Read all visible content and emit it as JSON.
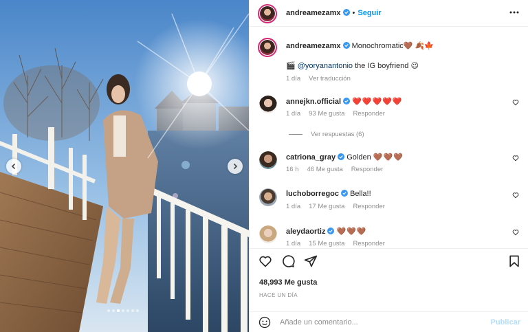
{
  "post": {
    "author": "andreamezamx",
    "follow_label": "Seguir",
    "more_icon": "more-options-icon",
    "carousel": {
      "total": 7,
      "current": 3
    }
  },
  "caption": {
    "author": "andreamezamx",
    "text": "Monochromatic",
    "emojis": "🤎 🍂🍁",
    "mention_prefix": "🎬",
    "mention": "@yoryanantonio",
    "mention_text": " the IG boyfriend",
    "mention_emoji": "😉",
    "time": "1 día",
    "translate": "Ver traducción"
  },
  "comments": [
    {
      "user": "annejkn.official",
      "text": "❤️❤️❤️❤️❤️",
      "time": "1 día",
      "likes": "93 Me gusta",
      "reply": "Responder",
      "hearts": "red"
    },
    {
      "user": "catriona_gray",
      "text": "Golden",
      "extra": "🤎🤎🤎",
      "time": "16 h",
      "likes": "46 Me gusta",
      "reply": "Responder",
      "hearts": "brown"
    },
    {
      "user": "luchoborregoc",
      "text": "Bella!!",
      "time": "1 día",
      "likes": "17 Me gusta",
      "reply": "Responder"
    },
    {
      "user": "aleydaortiz",
      "text": "🤎🤎🤎",
      "time": "1 día",
      "likes": "15 Me gusta",
      "reply": "Responder",
      "hearts": "brown"
    }
  ],
  "replies_label": "Ver respuestas (6)",
  "actions": {
    "likes": "48,993 Me gusta",
    "posted": "HACE UN DÍA"
  },
  "composer": {
    "placeholder": "Añade un comentario...",
    "publish": "Publicar"
  },
  "colors": {
    "accent": "#0095f6",
    "muted": "#8e8e8e",
    "text": "#262626",
    "verified": "#3897f0"
  }
}
